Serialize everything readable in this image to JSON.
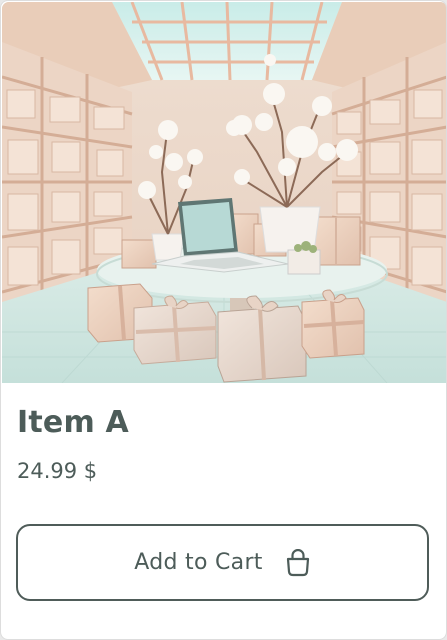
{
  "product": {
    "title": "Item A",
    "price": "24.99 $",
    "image_alt": "Store interior with laptop on round table surrounded by gift boxes"
  },
  "actions": {
    "add_to_cart_label": "Add to Cart",
    "add_to_cart_icon": "shopping-bag-icon"
  },
  "colors": {
    "text": "#4d5c59",
    "button_border": "#4f5c59",
    "card_background": "#ffffff"
  }
}
